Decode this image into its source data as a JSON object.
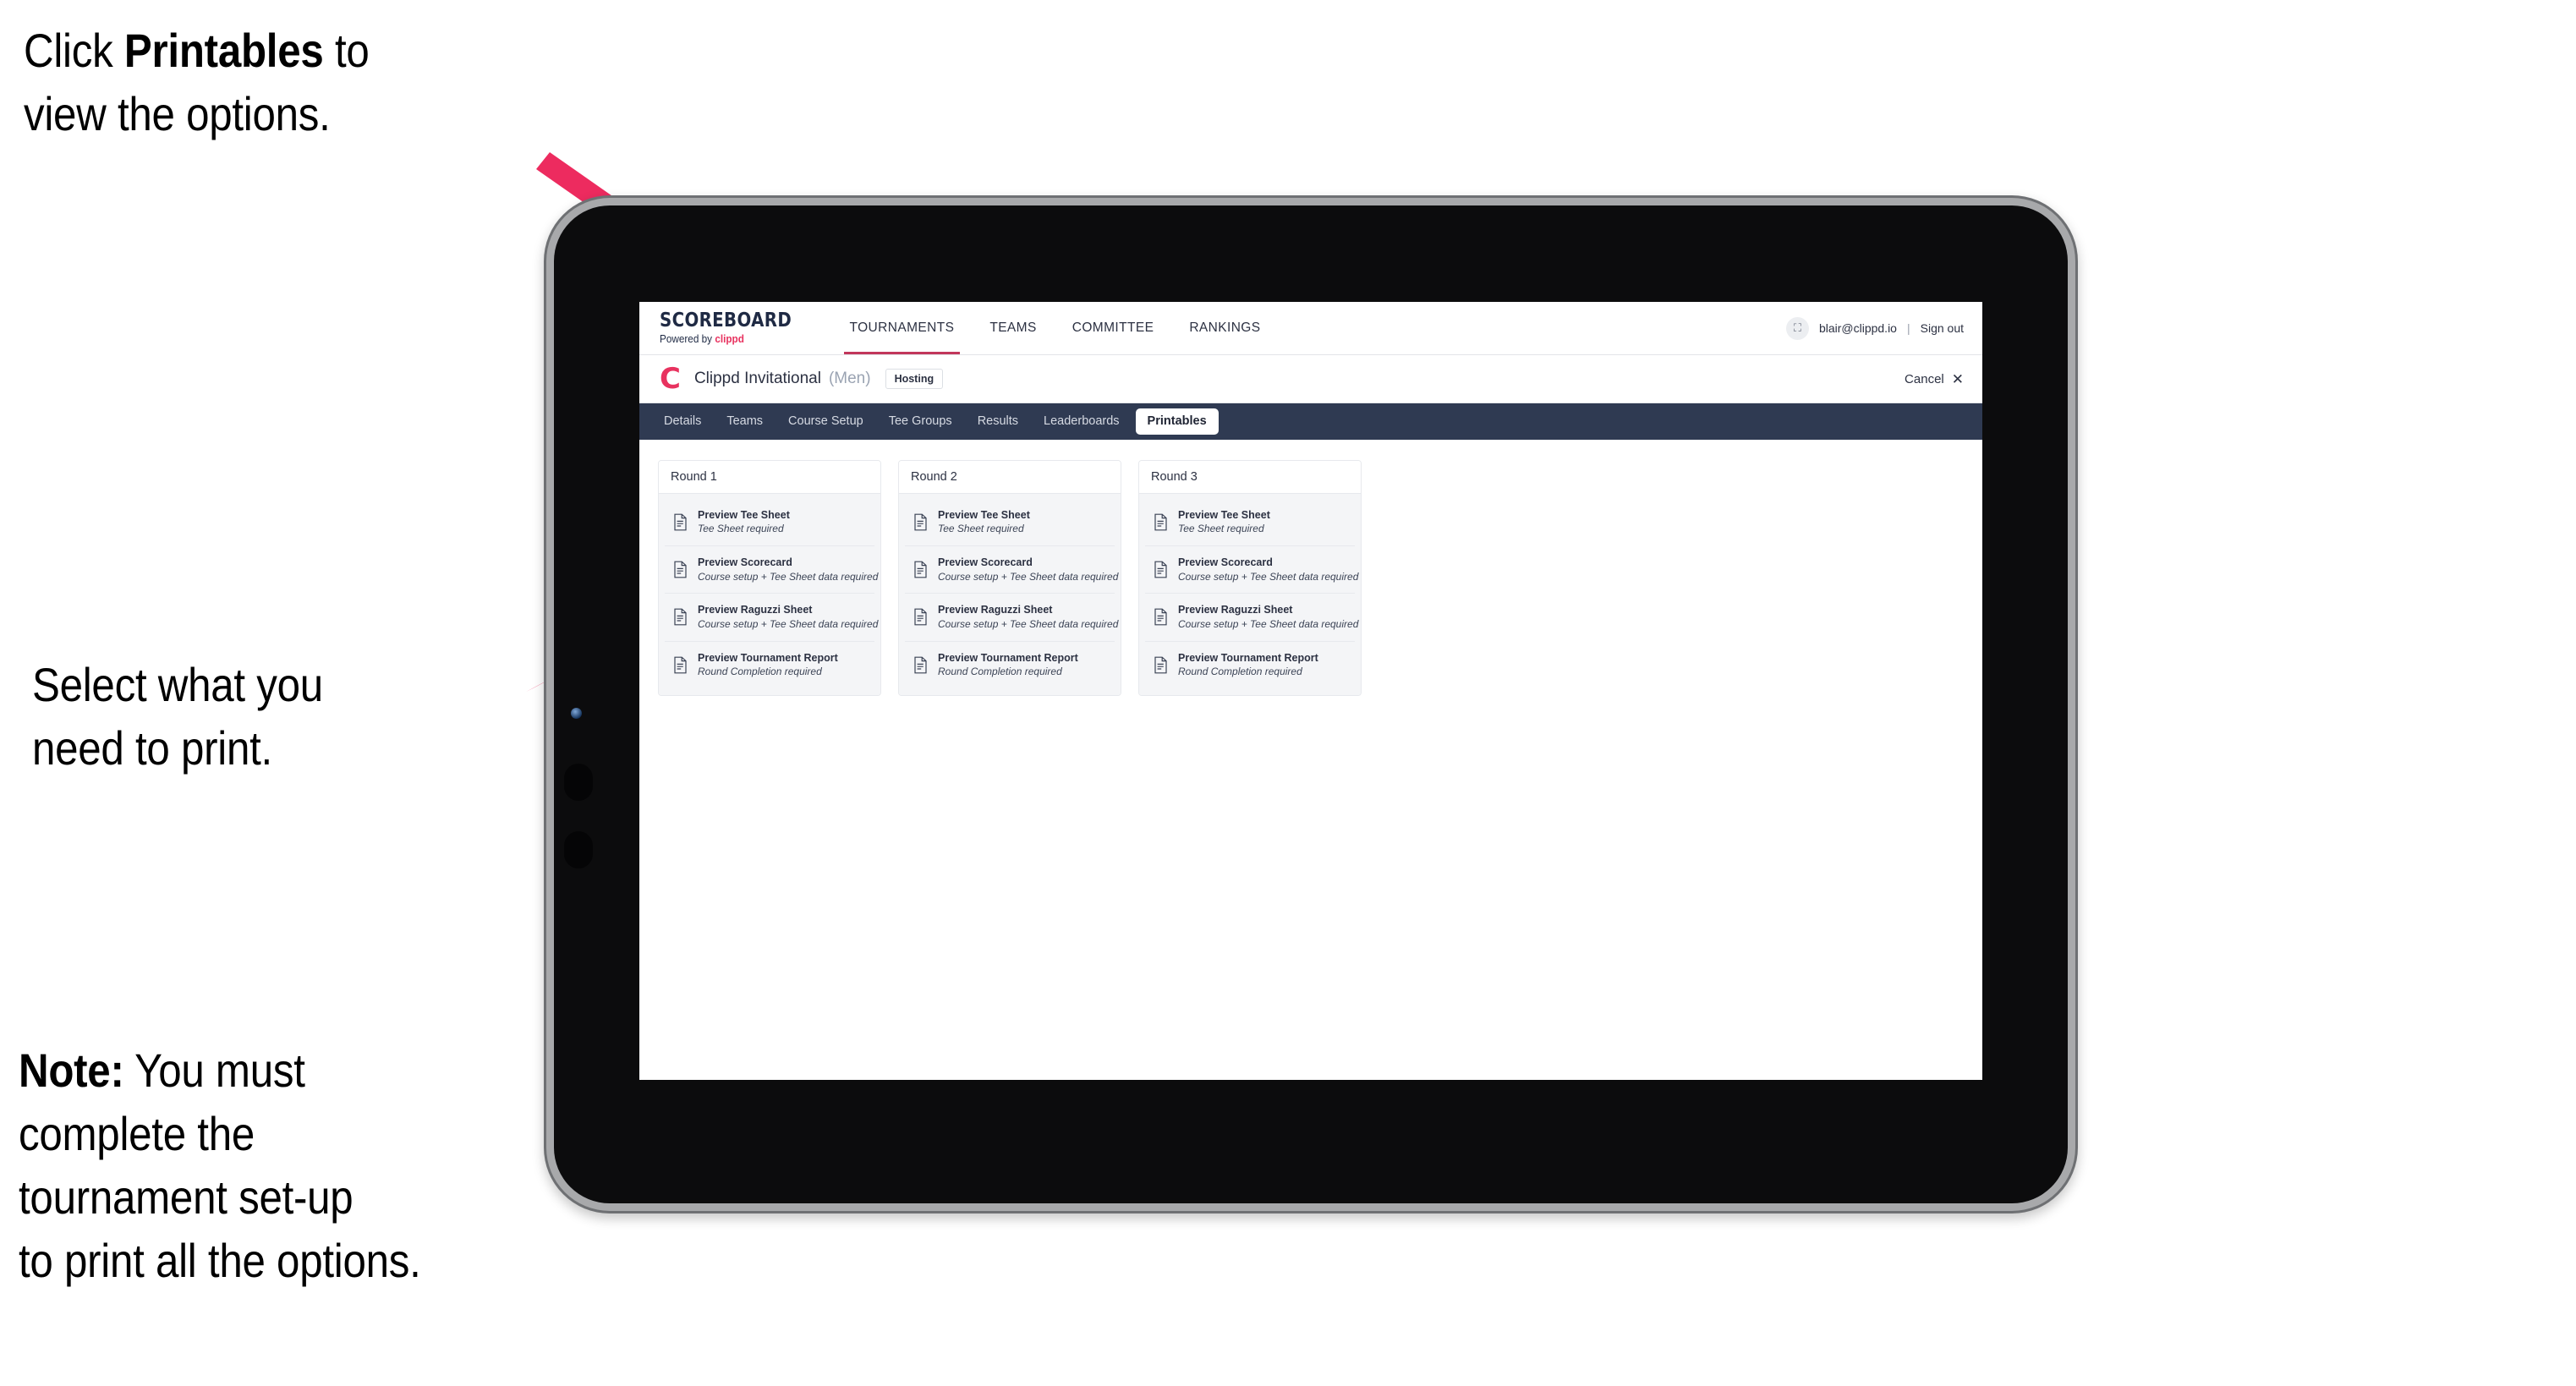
{
  "annotations": [
    {
      "id": "annot-1",
      "prefix": "Click ",
      "bold": "Printables",
      "suffix": " to\nview the options."
    },
    {
      "id": "annot-2",
      "prefix": "",
      "bold": "",
      "suffix": "Select what you\n need to print."
    },
    {
      "id": "annot-3",
      "prefix": "",
      "bold": "Note:",
      "suffix": " You must\ncomplete the\ntournament set-up\nto print all the options."
    }
  ],
  "annotation_text": {
    "first_line": "Click ",
    "first_bold": "Printables",
    "first_rest": " to\nview the options.",
    "second": "Select what you\n need to print.",
    "third_bold": "Note:",
    "third_rest": " You must\ncomplete the\ntournament set-up\nto print all the options."
  },
  "colors": {
    "arrow_pink": "#ED2B5F",
    "brand_pink": "#E8325F",
    "tab_bar_navy": "#2F3A52",
    "topnav_underline": "#C2375B",
    "device_bezel": "#0C0C0D",
    "device_frame": "#A8A9AB"
  },
  "app": {
    "brand": {
      "title": "SCOREBOARD",
      "powered_prefix": "Powered by ",
      "powered_brand": "clippd"
    },
    "topnav": [
      {
        "label": "TOURNAMENTS",
        "active": true
      },
      {
        "label": "TEAMS",
        "active": false
      },
      {
        "label": "COMMITTEE",
        "active": false
      },
      {
        "label": "RANKINGS",
        "active": false
      }
    ],
    "account": {
      "avatar_icon": "user-image-icon",
      "avatar_glyph": "⛶",
      "email": "blair@clippd.io",
      "separator": "|",
      "sign_out": "Sign out"
    },
    "tournament": {
      "logo_letter": "C",
      "name": "Clippd Invitational",
      "gender": "(Men)",
      "status_badge": "Hosting",
      "cancel_label": "Cancel",
      "cancel_icon": "close-icon",
      "cancel_glyph": "✕"
    },
    "tabs": [
      {
        "label": "Details",
        "active": false
      },
      {
        "label": "Teams",
        "active": false
      },
      {
        "label": "Course Setup",
        "active": false
      },
      {
        "label": "Tee Groups",
        "active": false
      },
      {
        "label": "Results",
        "active": false
      },
      {
        "label": "Leaderboards",
        "active": false
      },
      {
        "label": "Printables",
        "active": true
      }
    ],
    "rounds": [
      {
        "title": "Round 1",
        "items": [
          {
            "title": "Preview Tee Sheet",
            "subtitle": "Tee Sheet required"
          },
          {
            "title": "Preview Scorecard",
            "subtitle": "Course setup + Tee Sheet data required"
          },
          {
            "title": "Preview Raguzzi Sheet",
            "subtitle": "Course setup + Tee Sheet data required"
          },
          {
            "title": "Preview Tournament Report",
            "subtitle": "Round Completion required"
          }
        ]
      },
      {
        "title": "Round 2",
        "items": [
          {
            "title": "Preview Tee Sheet",
            "subtitle": "Tee Sheet required"
          },
          {
            "title": "Preview Scorecard",
            "subtitle": "Course setup + Tee Sheet data required"
          },
          {
            "title": "Preview Raguzzi Sheet",
            "subtitle": "Course setup + Tee Sheet data required"
          },
          {
            "title": "Preview Tournament Report",
            "subtitle": "Round Completion required"
          }
        ]
      },
      {
        "title": "Round 3",
        "items": [
          {
            "title": "Preview Tee Sheet",
            "subtitle": "Tee Sheet required"
          },
          {
            "title": "Preview Scorecard",
            "subtitle": "Course setup + Tee Sheet data required"
          },
          {
            "title": "Preview Raguzzi Sheet",
            "subtitle": "Course setup + Tee Sheet data required"
          },
          {
            "title": "Preview Tournament Report",
            "subtitle": "Round Completion required"
          }
        ]
      }
    ]
  }
}
